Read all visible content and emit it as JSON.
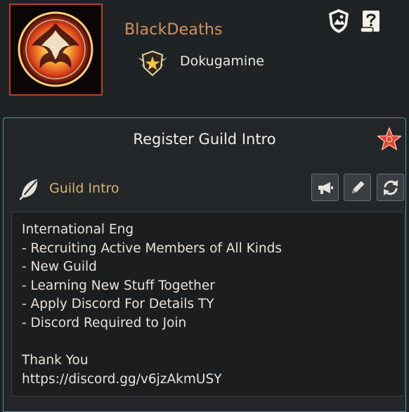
{
  "header": {
    "guild_name": "BlackDeaths",
    "leader_name": "Dokugamine",
    "icons": {
      "emblem": "phoenix-emblem-icon",
      "rank": "star-shield-rank-icon",
      "shield_button": "shield-icon",
      "scroll_button": "scroll-help-icon"
    }
  },
  "panel": {
    "title": "Register Guild Intro",
    "close_icon": "star-close-icon",
    "section_label": "Guild Intro",
    "section_icon": "feather-icon",
    "tools": [
      "megaphone-icon",
      "pencil-icon",
      "refresh-icon"
    ],
    "intro_lines": [
      "International Eng",
      "- Recruiting Active Members of All Kinds",
      "- New Guild",
      "- Learning New Stuff Together",
      "- Apply Discord For Details TY",
      "- Discord Required to Join",
      "",
      "Thank You",
      "https://discord.gg/v6jzAkmUSY"
    ]
  },
  "colors": {
    "background": "#1f2224",
    "panel_border": "#4a9a9c",
    "guild_name": "#d4925c",
    "section_label": "#d9b16e",
    "emblem_border": "#b4402a"
  }
}
